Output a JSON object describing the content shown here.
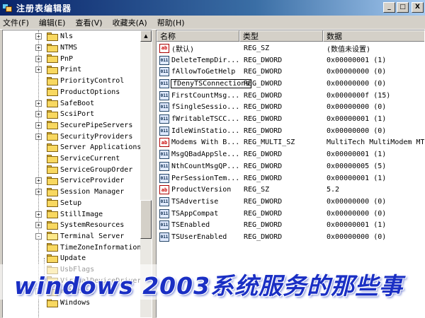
{
  "window": {
    "title": "注册表编辑器",
    "minimize_glyph": "_",
    "maximize_glyph": "□",
    "close_glyph": "X"
  },
  "menu": [
    {
      "label": "文件(F)"
    },
    {
      "label": "编辑(E)"
    },
    {
      "label": "查看(V)"
    },
    {
      "label": "收藏夹(A)"
    },
    {
      "label": "帮助(H)"
    }
  ],
  "tree": {
    "items": [
      {
        "label": "Nls",
        "expander": "+"
      },
      {
        "label": "NTMS",
        "expander": "+"
      },
      {
        "label": "PnP",
        "expander": "+"
      },
      {
        "label": "Print",
        "expander": "+"
      },
      {
        "label": "PriorityControl",
        "expander": ""
      },
      {
        "label": "ProductOptions",
        "expander": ""
      },
      {
        "label": "SafeBoot",
        "expander": "+"
      },
      {
        "label": "ScsiPort",
        "expander": "+"
      },
      {
        "label": "SecurePipeServers",
        "expander": "+"
      },
      {
        "label": "SecurityProviders",
        "expander": "+"
      },
      {
        "label": "Server Applications",
        "expander": ""
      },
      {
        "label": "ServiceCurrent",
        "expander": ""
      },
      {
        "label": "ServiceGroupOrder",
        "expander": ""
      },
      {
        "label": "ServiceProvider",
        "expander": "+"
      },
      {
        "label": "Session Manager",
        "expander": "+"
      },
      {
        "label": "Setup",
        "expander": ""
      },
      {
        "label": "StillImage",
        "expander": "+"
      },
      {
        "label": "SystemResources",
        "expander": "+"
      },
      {
        "label": "Terminal Server",
        "expander": "-"
      },
      {
        "label": "TimeZoneInformation",
        "expander": ""
      },
      {
        "label": "Update",
        "expander": ""
      },
      {
        "label": "UsbFlags",
        "expander": ""
      },
      {
        "label": "VirtualDeviceDrivers",
        "expander": ""
      },
      {
        "label": "Watchdog",
        "expander": "+"
      },
      {
        "label": "Windows",
        "expander": ""
      }
    ],
    "scroll_up_glyph": "▲"
  },
  "columns": {
    "name": "名称",
    "type": "类型",
    "data": "数据"
  },
  "values": [
    {
      "icon": "ab",
      "name": "(默认)",
      "type": "REG_SZ",
      "data": "(数值未设置)"
    },
    {
      "icon": "bin",
      "name": "DeleteTempDir...",
      "type": "REG_DWORD",
      "data": "0x00000001 (1)"
    },
    {
      "icon": "bin",
      "name": "fAllowToGetHelp",
      "type": "REG_DWORD",
      "data": "0x00000000 (0)"
    },
    {
      "icon": "bin",
      "name": "fDenyTSConnections",
      "type": "REG_DWORD",
      "data": "0x00000000 (0)"
    },
    {
      "icon": "bin",
      "name": "FirstCountMsg...",
      "type": "REG_DWORD",
      "data": "0x0000000f (15)"
    },
    {
      "icon": "bin",
      "name": "fSingleSessio...",
      "type": "REG_DWORD",
      "data": "0x00000000 (0)"
    },
    {
      "icon": "bin",
      "name": "fWritableTSCC...",
      "type": "REG_DWORD",
      "data": "0x00000001 (1)"
    },
    {
      "icon": "bin",
      "name": "IdleWinStatio...",
      "type": "REG_DWORD",
      "data": "0x00000000 (0)"
    },
    {
      "icon": "ab",
      "name": "Modems With B...",
      "type": "REG_MULTI_SZ",
      "data": "MultiTech MultiModem MT"
    },
    {
      "icon": "bin",
      "name": "MsgQBadAppSle...",
      "type": "REG_DWORD",
      "data": "0x00000001 (1)"
    },
    {
      "icon": "bin",
      "name": "NthCountMsgQP...",
      "type": "REG_DWORD",
      "data": "0x00000005 (5)"
    },
    {
      "icon": "bin",
      "name": "PerSessionTem...",
      "type": "REG_DWORD",
      "data": "0x00000001 (1)"
    },
    {
      "icon": "ab",
      "name": "ProductVersion",
      "type": "REG_SZ",
      "data": "5.2"
    },
    {
      "icon": "bin",
      "name": "TSAdvertise",
      "type": "REG_DWORD",
      "data": "0x00000000 (0)"
    },
    {
      "icon": "bin",
      "name": "TSAppCompat",
      "type": "REG_DWORD",
      "data": "0x00000000 (0)"
    },
    {
      "icon": "bin",
      "name": "TSEnabled",
      "type": "REG_DWORD",
      "data": "0x00000001 (1)"
    },
    {
      "icon": "bin",
      "name": "TSUserEnabled",
      "type": "REG_DWORD",
      "data": "0x00000000 (0)"
    }
  ],
  "caption": "windows 2003系统服务的那些事",
  "icons": {
    "string_value": "string-value-icon",
    "binary_value": "dword-value-icon",
    "folder": "folder-icon"
  },
  "colors": {
    "titlebar": "#0a246a",
    "caption_text": "#1a2fc4"
  }
}
